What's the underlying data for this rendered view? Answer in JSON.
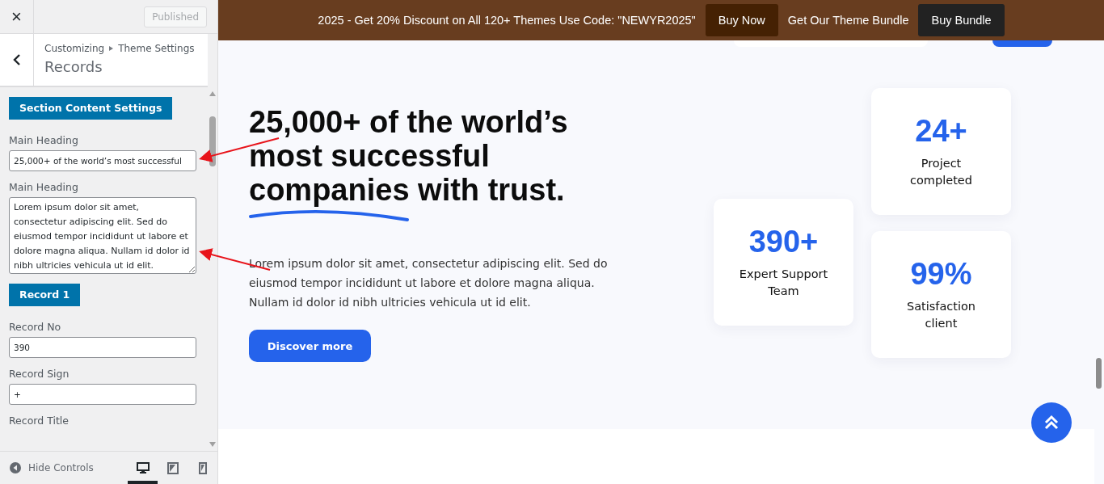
{
  "sidebar": {
    "close": "×",
    "publish_button": {
      "label": "Published",
      "disabled": true
    },
    "breadcrumb": [
      "Customizing",
      "Theme Settings"
    ],
    "title": "Records",
    "controls": [
      {
        "kind": "section",
        "label": "Section Content Settings"
      },
      {
        "kind": "input",
        "label": "Main Heading",
        "value": "25,000+ of the world’s most successful"
      },
      {
        "kind": "textarea",
        "label": "Main Heading",
        "value": "Lorem ipsum dolor sit amet, consectetur adipiscing elit. Sed do eiusmod tempor incididunt ut labore et dolore magna aliqua. Nullam id dolor id nibh ultricies vehicula ut id elit."
      },
      {
        "kind": "section",
        "label": "Record 1"
      },
      {
        "kind": "input",
        "label": "Record No",
        "value": "390"
      },
      {
        "kind": "input",
        "label": "Record Sign",
        "value": "+"
      },
      {
        "kind": "heading",
        "label": "Record Title"
      }
    ],
    "footer": {
      "hide_controls": "Hide Controls",
      "devices": [
        {
          "kind": "desktop",
          "selected": true
        },
        {
          "kind": "tablet",
          "selected": false
        },
        {
          "kind": "mobile",
          "selected": false
        }
      ]
    }
  },
  "banner": {
    "text": "2025 - Get 20% Discount on All 120+ Themes Use Code: \"NEWYR2025\"",
    "buy_now": "Buy Now",
    "bundle_text": "Get Our Theme Bundle",
    "buy_bundle": "Buy Bundle"
  },
  "hero": {
    "heading_before": "25,000+ of the world’s most successful",
    "heading_underlined": "companies",
    "heading_after": "with trust.",
    "paragraph": "Lorem ipsum dolor sit amet, consectetur adipiscing elit. Sed do eiusmod tempor incididunt ut labore et dolore magna aliqua. Nullam id dolor id nibh ultricies vehicula ut id elit.",
    "button": "Discover more"
  },
  "stats": [
    {
      "value": "390+",
      "label": "Expert Support Team"
    },
    {
      "value": "24+",
      "label": "Project completed"
    },
    {
      "value": "99%",
      "label": "Satisfaction client"
    }
  ]
}
